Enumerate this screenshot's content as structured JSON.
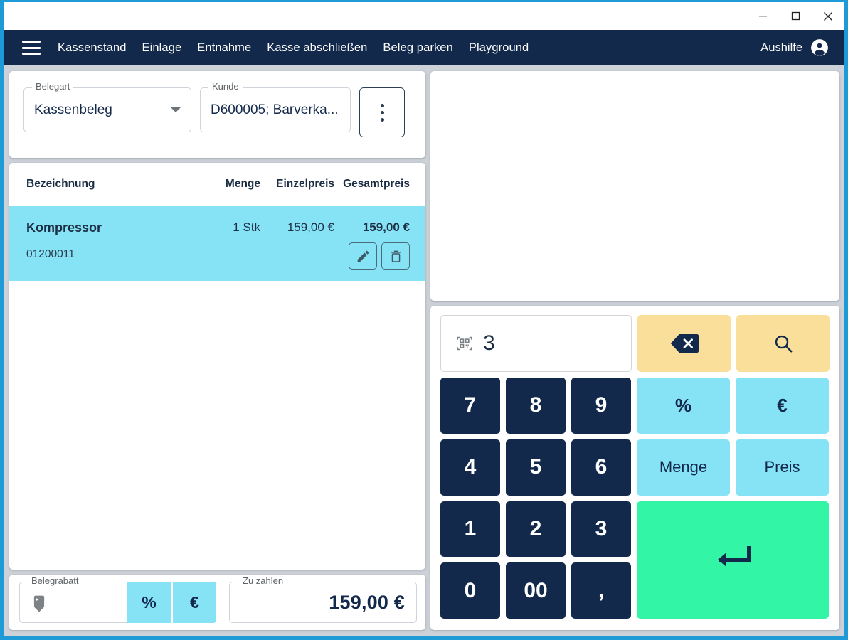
{
  "window": {
    "controls": [
      {
        "name": "minimize",
        "glyph": "minimize-icon"
      },
      {
        "name": "maximize",
        "glyph": "maximize-icon"
      },
      {
        "name": "close",
        "glyph": "close-icon"
      }
    ]
  },
  "nav": {
    "menu_icon": "hamburger-menu-icon",
    "items": [
      {
        "label": "Kassenstand"
      },
      {
        "label": "Einlage"
      },
      {
        "label": "Entnahme"
      },
      {
        "label": "Kasse abschließen"
      },
      {
        "label": "Beleg parken"
      },
      {
        "label": "Playground"
      }
    ],
    "user": {
      "name": "Aushilfe",
      "icon": "account-circle-icon"
    }
  },
  "form": {
    "belegart": {
      "legend": "Belegart",
      "value": "Kassenbeleg",
      "caret_icon": "chevron-down-icon"
    },
    "kunde": {
      "legend": "Kunde",
      "value": "D600005; Barverka..."
    },
    "more_button": {
      "icon": "kebab-menu-icon"
    }
  },
  "items_table": {
    "columns": [
      {
        "key": "name",
        "label": "Bezeichnung"
      },
      {
        "key": "qty",
        "label": "Menge"
      },
      {
        "key": "unit",
        "label": "Einzelpreis"
      },
      {
        "key": "total",
        "label": "Gesamtpreis"
      }
    ],
    "rows": [
      {
        "name": "Kompressor",
        "qty": "1 Stk",
        "unit": "159,00 €",
        "total": "159,00 €",
        "sku": "01200011",
        "selected": true,
        "actions": [
          {
            "name": "edit",
            "icon": "pencil-icon"
          },
          {
            "name": "delete",
            "icon": "trash-icon"
          }
        ]
      }
    ]
  },
  "footer": {
    "discount": {
      "legend": "Belegrabatt",
      "value": "",
      "icon": "price-tag-icon",
      "percent_label": "%",
      "euro_label": "€"
    },
    "total": {
      "legend": "Zu zahlen",
      "value": "159,00 €"
    }
  },
  "keypad": {
    "scan_field": {
      "icon": "qr-scan-icon",
      "value": "3"
    },
    "backspace": {
      "icon": "backspace-icon"
    },
    "search": {
      "icon": "search-icon"
    },
    "keys": [
      {
        "label": "7",
        "type": "num"
      },
      {
        "label": "8",
        "type": "num"
      },
      {
        "label": "9",
        "type": "num"
      },
      {
        "label": "%",
        "type": "cyan-sym"
      },
      {
        "label": "€",
        "type": "cyan-sym"
      },
      {
        "label": "4",
        "type": "num"
      },
      {
        "label": "5",
        "type": "num"
      },
      {
        "label": "6",
        "type": "num"
      },
      {
        "label": "Menge",
        "type": "cyan"
      },
      {
        "label": "Preis",
        "type": "cyan"
      },
      {
        "label": "1",
        "type": "num"
      },
      {
        "label": "2",
        "type": "num"
      },
      {
        "label": "3",
        "type": "num"
      },
      {
        "label": "0",
        "type": "num"
      },
      {
        "label": "00",
        "type": "num"
      },
      {
        "label": ",",
        "type": "num"
      }
    ],
    "enter": {
      "icon": "enter-arrow-icon"
    }
  },
  "colors": {
    "nav_bg": "#13294b",
    "accent_cyan": "#86E3F5",
    "accent_yellow": "#FADF9B",
    "accent_green": "#33F5A6",
    "app_bg": "#ccd2d8",
    "frame": "#1e9ad6"
  }
}
